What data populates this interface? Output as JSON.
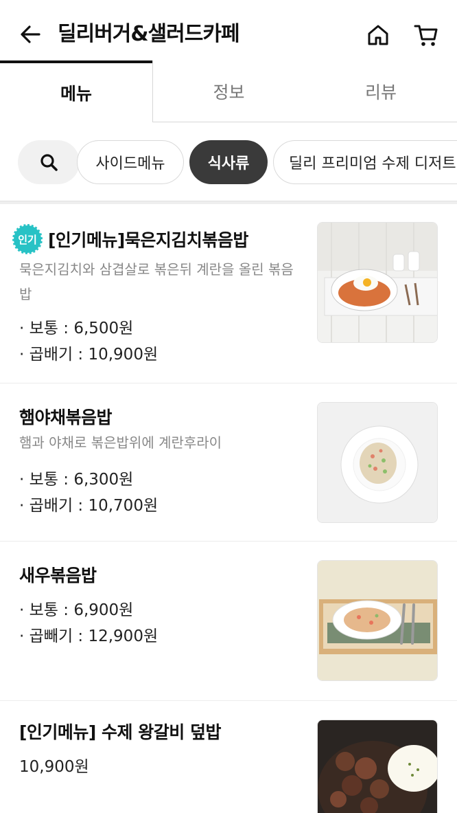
{
  "header": {
    "title": "딜리버거&샐러드카페",
    "icons": {
      "back": "arrow-left-icon",
      "home": "home-icon",
      "cart": "cart-icon"
    }
  },
  "tabs": [
    {
      "label": "메뉴",
      "active": true
    },
    {
      "label": "정보",
      "active": false
    },
    {
      "label": "리뷰",
      "active": false
    }
  ],
  "categories": {
    "search_icon": "search-icon",
    "chips": [
      {
        "label": "사이드메뉴",
        "selected": false
      },
      {
        "label": "식사류",
        "selected": true
      },
      {
        "label": "딜리 프리미엄 수제 디저트",
        "selected": false
      }
    ]
  },
  "menu": [
    {
      "badge": "인기",
      "name": "[인기메뉴]묵은지김치볶음밥",
      "desc": "묵은지김치와 삼겹살로 볶은뒤 계란을 올린 볶음밥",
      "prices": [
        "· 보통 : 6,500원",
        "· 곱배기 : 10,900원"
      ]
    },
    {
      "name": "햄야채볶음밥",
      "desc": "햄과 야채로 볶은밥위에 계란후라이",
      "prices": [
        "· 보통 : 6,300원",
        "· 곱배기 : 10,700원"
      ]
    },
    {
      "name": "새우볶음밥",
      "prices": [
        "· 보통 : 6,900원",
        "· 곱빼기 : 12,900원"
      ]
    },
    {
      "name": "[인기메뉴] 수제 왕갈비 덮밥",
      "prices": [
        "10,900원"
      ]
    }
  ],
  "colors": {
    "accent_badge": "#27c2c5",
    "selected_chip": "#3a3a3a",
    "muted_text": "#888888"
  }
}
